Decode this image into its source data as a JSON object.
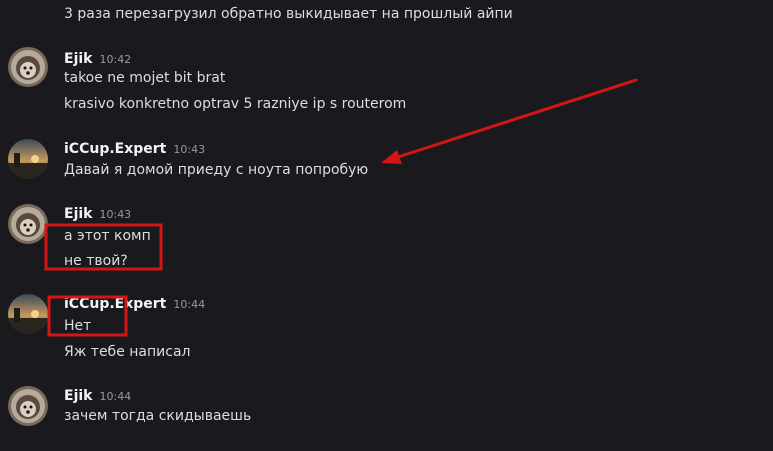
{
  "messages": [
    {
      "lines": [
        "3 раза перезагрузил обратно выкидывает на прошлый айпи"
      ]
    },
    {
      "author": "Ejik",
      "time": "10:42",
      "lines": [
        "takoe ne mojet  bit brat",
        "krasivo konkretno optrav 5 razniye ip s routerom"
      ]
    },
    {
      "author": "iCCup.Expert",
      "time": "10:43",
      "lines": [
        "Давай я домой приеду с ноута попробую"
      ]
    },
    {
      "author": "Ejik",
      "time": "10:43",
      "lines": [
        "а этот комп",
        "не твой?"
      ]
    },
    {
      "author": "iCCup.Expert",
      "time": "10:44",
      "lines": [
        "Нет",
        "Яж тебе написал"
      ]
    },
    {
      "author": "Ejik",
      "time": "10:44",
      "lines": [
        "зачем тогда скидываешь"
      ]
    }
  ],
  "colors": {
    "background": "#1a1a1e",
    "text": "#dbdee1",
    "author": "#f2f3f5",
    "timestamp": "#949ba4",
    "annotation": "#d41515"
  },
  "icons": {
    "ejik_avatar": "hedgehog-avatar-icon",
    "expert_avatar": "sunset-avatar-icon"
  }
}
